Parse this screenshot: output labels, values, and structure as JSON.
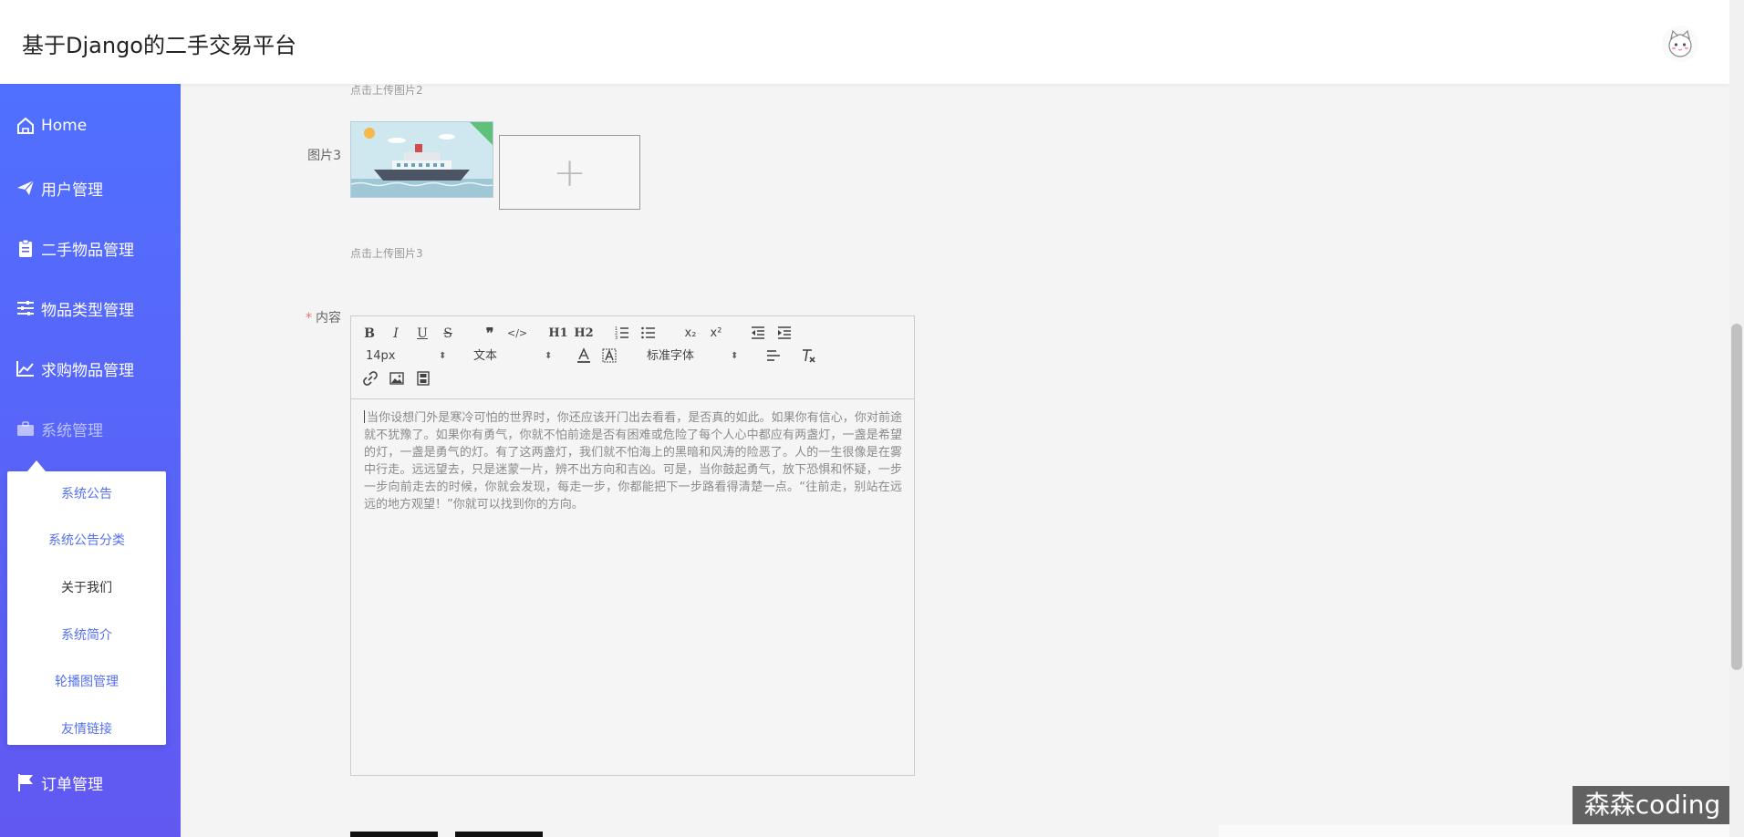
{
  "header": {
    "title": "基于Django的二手交易平台"
  },
  "sidebar": {
    "items": [
      {
        "label": "Home",
        "icon": "home-icon"
      },
      {
        "label": "用户管理",
        "icon": "paper-plane-icon"
      },
      {
        "label": "二手物品管理",
        "icon": "clipboard-icon"
      },
      {
        "label": "物品类型管理",
        "icon": "sliders-icon"
      },
      {
        "label": "求购物品管理",
        "icon": "chart-line-icon"
      },
      {
        "label": "系统管理",
        "icon": "briefcase-icon"
      },
      {
        "label": "订单管理",
        "icon": "flag-icon"
      }
    ],
    "submenu": [
      {
        "label": "系统公告"
      },
      {
        "label": "系统公告分类"
      },
      {
        "label": "关于我们"
      },
      {
        "label": "系统简介"
      },
      {
        "label": "轮播图管理"
      },
      {
        "label": "友情链接"
      }
    ]
  },
  "form": {
    "hint2": "点击上传图片2",
    "image3_label": "图片3",
    "hint3": "点击上传图片3",
    "content_label": "内容",
    "required_mark": "*",
    "upload_plus": "+"
  },
  "editor": {
    "buttons": {
      "bold": "B",
      "italic": "I",
      "underline": "U",
      "strike": "S",
      "blockquote": "❞",
      "code": "</>",
      "h1": "H1",
      "h2": "H2",
      "sub": "x₂",
      "sup": "x²"
    },
    "size_value": "14px",
    "header_value": "文本",
    "font_value": "标准字体",
    "content": "当你设想门外是寒冷可怕的世界时，你还应该开门出去看看，是否真的如此。如果你有信心，你对前途就不犹豫了。如果你有勇气，你就不怕前途是否有困难或危险了每个人心中都应有两盏灯，一盏是希望的灯，一盏是勇气的灯。有了这两盏灯，我们就不怕海上的黑暗和风涛的险恶了。人的一生很像是在雾中行走。远远望去，只是迷蒙一片，辨不出方向和吉凶。可是，当你鼓起勇气，放下恐惧和怀疑，一步一步向前走去的时候，你就会发现，每走一步，你都能把下一步路看得清楚一点。“往前走，别站在远远的地方观望！”你就可以找到你的方向。"
  },
  "watermark": "森森coding",
  "colors": {
    "sidebar_top": "#5070ff",
    "sidebar_bottom": "#6158f2",
    "submenu_link": "#5470f0",
    "required": "#f56c6c"
  }
}
